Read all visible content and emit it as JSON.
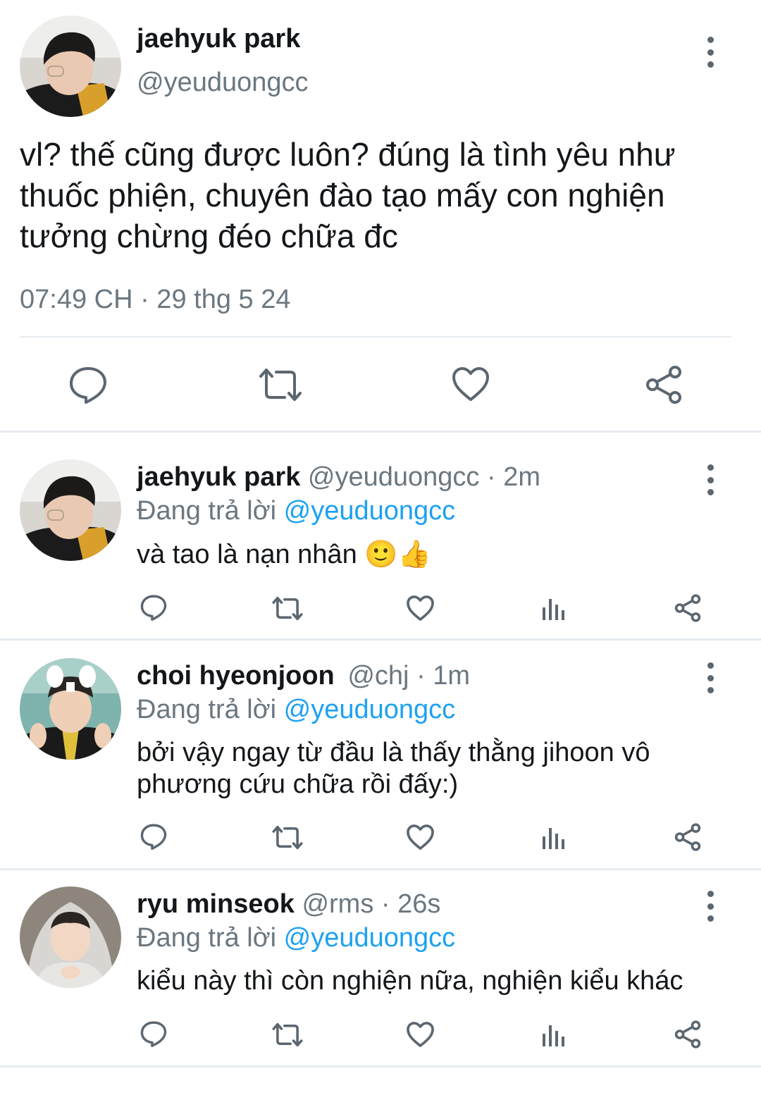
{
  "main_tweet": {
    "name": "jaehyuk park",
    "handle": "@yeuduongcc",
    "text_lines": [
      "vl? thế cũng được luôn? đúng là tình yêu như",
      "thuốc phiện, chuyên đào tạo mấy con nghiện",
      "tưởng chừng đéo chữa đc"
    ],
    "timestamp": "07:49 CH · 29 thg 5 24",
    "actions": [
      "reply-icon",
      "retweet-icon",
      "like-icon",
      "share-icon"
    ]
  },
  "replies": [
    {
      "name": "jaehyuk park",
      "handle": "@yeuduongcc",
      "time": "· 2m",
      "reply_prefix": "Đang trả lời",
      "reply_to": "@yeuduongcc",
      "text": "và tao là nạn nhân 🙂👍"
    },
    {
      "name": "choi hyeonjoon",
      "handle": "@chj",
      "time": "· 1m",
      "reply_prefix": "Đang trả lời",
      "reply_to": "@yeuduongcc",
      "text": "bởi vậy ngay từ đầu là thấy thằng jihoon vô phương cứu chữa rồi đấy:)"
    },
    {
      "name": "ryu minseok",
      "handle": "@rms",
      "time": "· 26s",
      "reply_prefix": "Đang trả lời",
      "reply_to": "@yeuduongcc",
      "text": "kiểu này thì còn nghiện nữa, nghiện kiểu khác"
    }
  ],
  "colors": {
    "link": "#1da1f2",
    "secondary_text": "#6b7780",
    "icon": "#5b6670",
    "divider": "#e6ecf0"
  }
}
